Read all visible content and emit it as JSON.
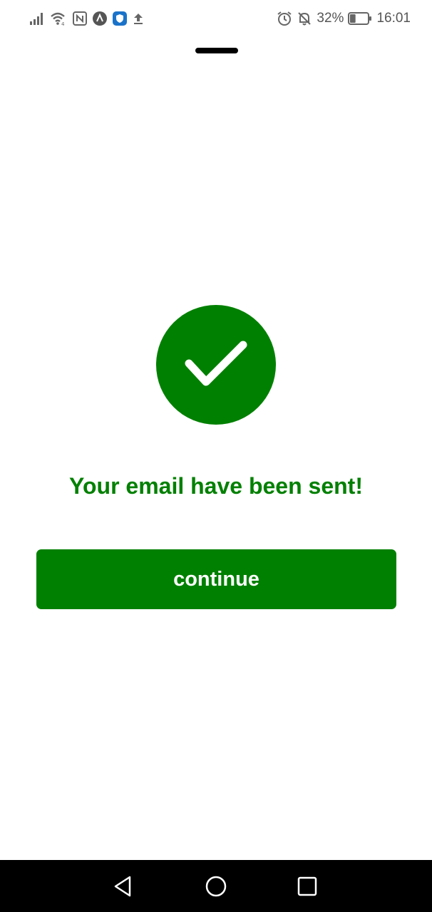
{
  "status_bar": {
    "battery_percent": "32%",
    "time": "16:01",
    "left_icons": [
      "signal-icon",
      "wifi-icon",
      "nfc-icon",
      "app-a-icon",
      "shield-app-icon",
      "upload-icon"
    ],
    "right_icons": [
      "alarm-icon",
      "bell-off-icon",
      "battery-icon"
    ],
    "battery_level": 0.32
  },
  "success": {
    "icon": "check-icon",
    "message": "Your email have been sent!",
    "continue_label": "continue"
  },
  "navigation_bar": {
    "buttons": [
      "back-icon",
      "home-icon",
      "recents-icon"
    ]
  },
  "colors": {
    "accent": "#008000",
    "status_text": "#555555",
    "nav_background": "#000000",
    "background": "#ffffff"
  }
}
